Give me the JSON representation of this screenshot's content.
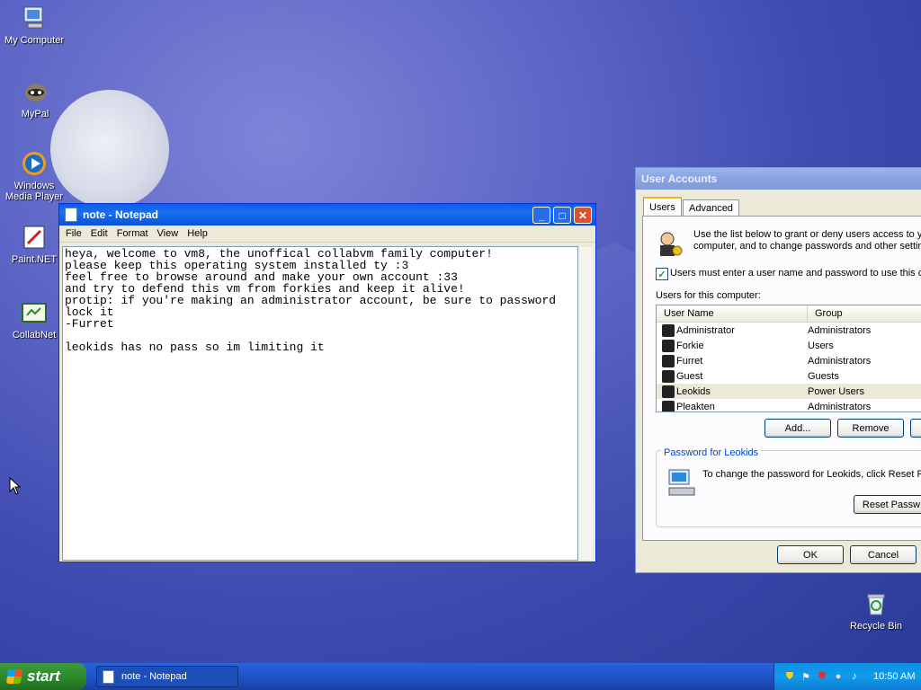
{
  "desktop": {
    "icons": [
      {
        "label": "My Computer"
      },
      {
        "label": "MyPal"
      },
      {
        "label": "Windows Media Player"
      },
      {
        "label": "Paint.NET"
      },
      {
        "label": "CollabNet"
      },
      {
        "label": "Recycle Bin"
      }
    ]
  },
  "notepad": {
    "title": "note - Notepad",
    "menu": [
      "File",
      "Edit",
      "Format",
      "View",
      "Help"
    ],
    "content": "heya, welcome to vm8, the unoffical collabvm family computer!\nplease keep this operating system installed ty :3\nfeel free to browse around and make your own account :33\nand try to defend this vm from forkies and keep it alive!\nprotip: if you're making an administrator account, be sure to password\nlock it\n-Furret\n\nleokids has no pass so im limiting it"
  },
  "user_accounts": {
    "title": "User Accounts",
    "tabs": [
      "Users",
      "Advanced"
    ],
    "description": "Use the list below to grant or deny users access to y computer, and to change passwords and other settin",
    "checkbox_label": "Users must enter a user name and password to use this co",
    "checkbox_checked": true,
    "list_label": "Users for this computer:",
    "columns": [
      "User Name",
      "Group"
    ],
    "users": [
      {
        "name": "Administrator",
        "group": "Administrators"
      },
      {
        "name": "Forkie",
        "group": "Users"
      },
      {
        "name": "Furret",
        "group": "Administrators"
      },
      {
        "name": "Guest",
        "group": "Guests"
      },
      {
        "name": "Leokids",
        "group": "Power Users"
      },
      {
        "name": "Pleakten",
        "group": "Administrators"
      }
    ],
    "selected_user": "Leokids",
    "buttons": {
      "add": "Add...",
      "remove": "Remove"
    },
    "password_group_label": "Password for Leokids",
    "password_text": "To change the password for Leokids, click Reset Pa",
    "reset_button": "Reset Passw",
    "ok": "OK",
    "cancel": "Cancel"
  },
  "taskbar": {
    "start_label": "start",
    "task_button": "note - Notepad",
    "clock": "10:50 AM"
  }
}
